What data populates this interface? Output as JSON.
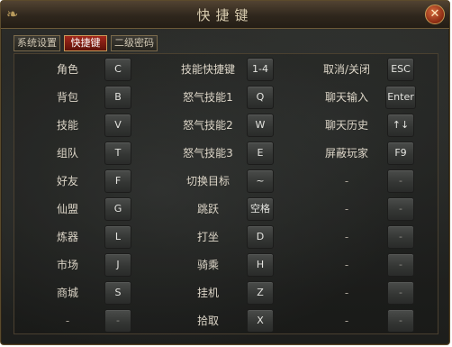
{
  "window": {
    "title": "快捷键",
    "close_icon": "close-icon"
  },
  "tabs": [
    {
      "label": "系统设置",
      "active": false
    },
    {
      "label": "快捷键",
      "active": true
    },
    {
      "label": "二级密码",
      "active": false
    }
  ],
  "columns": [
    [
      {
        "label": "角色",
        "key": "C"
      },
      {
        "label": "背包",
        "key": "B"
      },
      {
        "label": "技能",
        "key": "V"
      },
      {
        "label": "组队",
        "key": "T"
      },
      {
        "label": "好友",
        "key": "F"
      },
      {
        "label": "仙盟",
        "key": "G"
      },
      {
        "label": "炼器",
        "key": "L"
      },
      {
        "label": "市场",
        "key": "J"
      },
      {
        "label": "商城",
        "key": "S"
      },
      {
        "label": "-",
        "key": "-"
      }
    ],
    [
      {
        "label": "技能快捷键",
        "key": "1-4"
      },
      {
        "label": "怒气技能1",
        "key": "Q"
      },
      {
        "label": "怒气技能2",
        "key": "W"
      },
      {
        "label": "怒气技能3",
        "key": "E"
      },
      {
        "label": "切换目标",
        "key": "~"
      },
      {
        "label": "跳跃",
        "key": "空格"
      },
      {
        "label": "打坐",
        "key": "D"
      },
      {
        "label": "骑乘",
        "key": "H"
      },
      {
        "label": "挂机",
        "key": "Z"
      },
      {
        "label": "拾取",
        "key": "X"
      }
    ],
    [
      {
        "label": "取消/关闭",
        "key": "ESC"
      },
      {
        "label": "聊天输入",
        "key": "Enter"
      },
      {
        "label": "聊天历史",
        "key": "↑↓"
      },
      {
        "label": "屏蔽玩家",
        "key": "F9"
      },
      {
        "label": "-",
        "key": "-"
      },
      {
        "label": "-",
        "key": "-"
      },
      {
        "label": "-",
        "key": "-"
      },
      {
        "label": "-",
        "key": "-"
      },
      {
        "label": "-",
        "key": "-"
      },
      {
        "label": "-",
        "key": "-"
      }
    ]
  ]
}
